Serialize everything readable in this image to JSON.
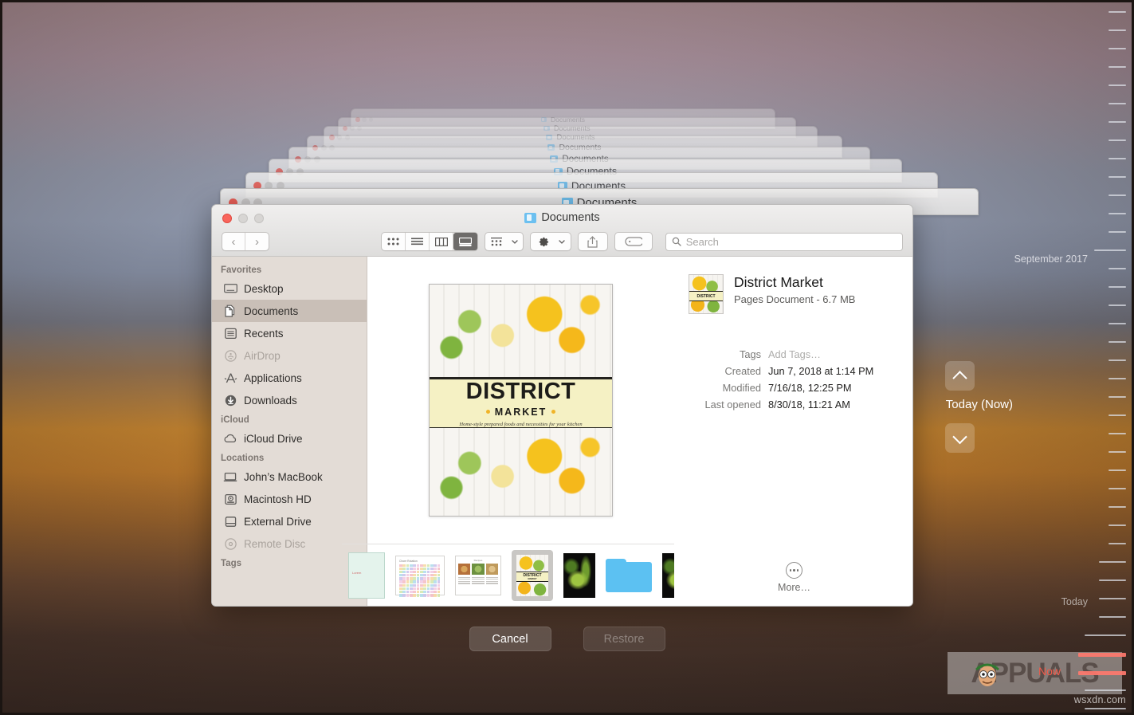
{
  "window": {
    "title": "Documents",
    "folder_icon": "folder-icon",
    "traffic_lights": [
      "close",
      "minimize",
      "zoom"
    ]
  },
  "stack": {
    "repeat_title": "Documents",
    "count": 8
  },
  "toolbar": {
    "back_label": "‹",
    "forward_label": "›",
    "view_icon_label": "icon-view",
    "view_list_label": "list-view",
    "view_column_label": "column-view",
    "view_gallery_label": "gallery-view",
    "arrange_label": "arrange-by",
    "action_label": "action-gear",
    "share_label": "share",
    "tags_label": "tags"
  },
  "search": {
    "placeholder": "Search",
    "value": ""
  },
  "sidebar": {
    "sections": [
      {
        "header": "Favorites",
        "items": [
          {
            "label": "Desktop",
            "icon": "desktop-icon",
            "state": "normal"
          },
          {
            "label": "Documents",
            "icon": "documents-icon",
            "state": "selected"
          },
          {
            "label": "Recents",
            "icon": "recents-icon",
            "state": "normal"
          },
          {
            "label": "AirDrop",
            "icon": "airdrop-icon",
            "state": "disabled"
          },
          {
            "label": "Applications",
            "icon": "applications-icon",
            "state": "normal"
          },
          {
            "label": "Downloads",
            "icon": "downloads-icon",
            "state": "normal"
          }
        ]
      },
      {
        "header": "iCloud",
        "items": [
          {
            "label": "iCloud Drive",
            "icon": "cloud-icon",
            "state": "normal"
          }
        ]
      },
      {
        "header": "Locations",
        "items": [
          {
            "label": "John’s MacBook",
            "icon": "laptop-icon",
            "state": "normal"
          },
          {
            "label": "Macintosh HD",
            "icon": "harddisk-icon",
            "state": "normal"
          },
          {
            "label": "External Drive",
            "icon": "external-drive-icon",
            "state": "normal"
          },
          {
            "label": "Remote Disc",
            "icon": "disc-icon",
            "state": "disabled"
          }
        ]
      },
      {
        "header": "Tags",
        "items": []
      }
    ]
  },
  "preview": {
    "cover_title": "DISTRICT",
    "cover_subtitle": "MARKET",
    "cover_tagline": "Home-style prepared foods and necessities for your kitchen"
  },
  "filmstrip": {
    "items": [
      {
        "name": "mint-document",
        "type": "document",
        "selected": false
      },
      {
        "name": "spreadsheet",
        "type": "spreadsheet",
        "selected": false
      },
      {
        "name": "recipe-layout",
        "type": "layout",
        "selected": false
      },
      {
        "name": "district-market",
        "type": "cover",
        "selected": true
      },
      {
        "name": "plant-photo",
        "type": "photo",
        "selected": false
      },
      {
        "name": "blue-folder",
        "type": "folder",
        "selected": false
      },
      {
        "name": "dark-plant-photo",
        "type": "photo",
        "selected": false
      }
    ]
  },
  "info": {
    "name": "District Market",
    "kind_and_size": "Pages Document - 6.7 MB",
    "rows": [
      {
        "label": "Tags",
        "value": "Add Tags…",
        "placeholder": true
      },
      {
        "label": "Created",
        "value": "Jun 7, 2018 at 1:14 PM",
        "placeholder": false
      },
      {
        "label": "Modified",
        "value": "7/16/18, 12:25 PM",
        "placeholder": false
      },
      {
        "label": "Last opened",
        "value": "8/30/18, 11:21 AM",
        "placeholder": false
      }
    ],
    "more_label": "More…"
  },
  "actions": {
    "cancel_label": "Cancel",
    "restore_label": "Restore",
    "restore_disabled": true
  },
  "timeline": {
    "top_label": "September 2017",
    "current_label": "Today (Now)",
    "today_label": "Today",
    "now_label": "Now",
    "up_arrow": "chevron-up-icon",
    "down_arrow": "chevron-down-icon"
  },
  "watermark": {
    "text": "APPUALS",
    "site": "wsxdn.com"
  },
  "colors": {
    "selection": "#c9bfb7",
    "sidebar_bg": "#e3dcd6",
    "folder_blue": "#6cc0f0",
    "close_red": "#f9655c",
    "now_red": "#f05a4a",
    "cover_band": "#f5f1c4"
  }
}
